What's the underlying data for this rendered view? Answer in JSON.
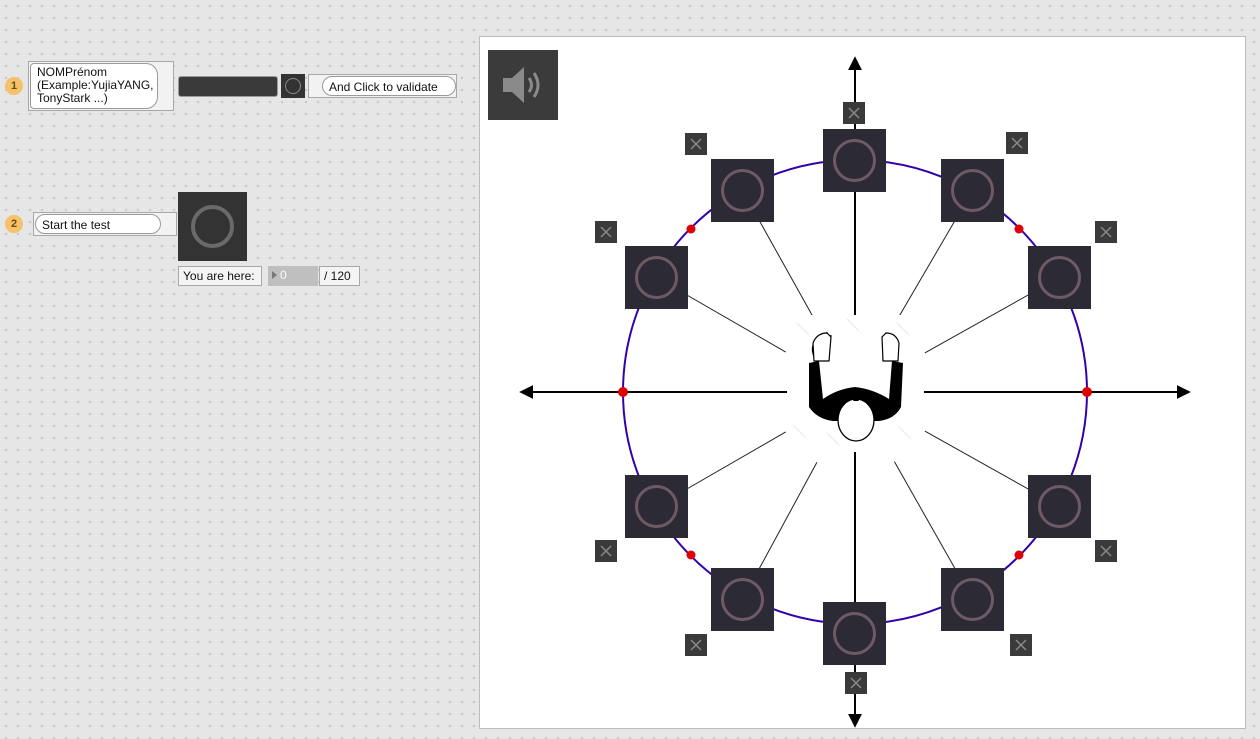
{
  "step1": {
    "badge": "1",
    "instruction": "NOMPrénom (Example:YujiaYANG, TonyStark ...)",
    "name_value": "",
    "validate_label": "And Click to validate"
  },
  "step2": {
    "badge": "2",
    "start_label": "Start the test",
    "progress_label": "You are here:",
    "progress_value": "0",
    "progress_total": "/ 120"
  },
  "canvas": {
    "speaker_icon": "speaker-icon",
    "center_image": "person-arms-raised-top-view",
    "targets": [
      {
        "id": "north"
      },
      {
        "id": "north-northeast"
      },
      {
        "id": "east-northeast"
      },
      {
        "id": "east-southeast"
      },
      {
        "id": "south-southeast"
      },
      {
        "id": "south"
      },
      {
        "id": "south-southwest"
      },
      {
        "id": "west-southwest"
      },
      {
        "id": "west-northwest"
      },
      {
        "id": "north-northwest"
      }
    ],
    "colors": {
      "circle": "#3300aa",
      "marker": "#e00000",
      "target_bg": "#2b2a35",
      "target_ring": "#6e5a64"
    }
  }
}
